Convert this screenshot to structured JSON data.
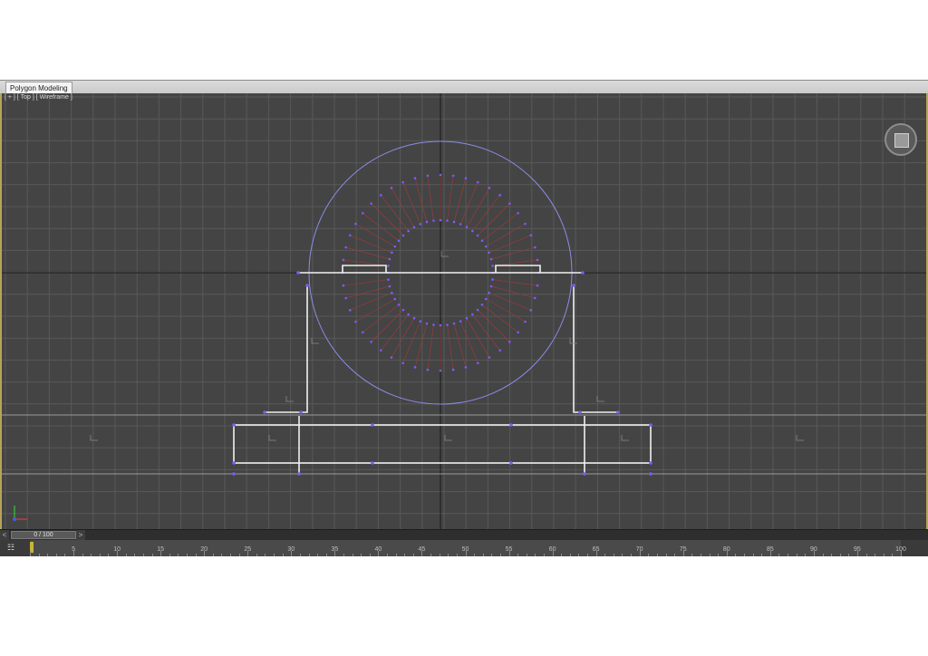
{
  "ribbon": {
    "panel_label": "Polygon Modeling"
  },
  "viewport": {
    "label_parts": [
      "[ + ]",
      "[ Top ]",
      "[ Wireframe ]"
    ],
    "view": "Top",
    "shading": "Wireframe",
    "colors": {
      "background": "#444444",
      "grid": "#595959",
      "axis": "#1a1a1a",
      "shape_white": "#f0f0f0",
      "shape_blue": "#8c8ce8",
      "vertex": "#7a5cff",
      "spoke_red": "#9b3a3a",
      "active_border": "#b8a35a"
    }
  },
  "time_slider": {
    "label": "0 / 100",
    "left_arrow": "<",
    "right_arrow": ">"
  },
  "timeline": {
    "icon": "key-filter-icon",
    "ticks": [
      "5",
      "10",
      "15",
      "20",
      "25",
      "30",
      "35",
      "40",
      "45",
      "50",
      "55",
      "60",
      "65",
      "70",
      "75",
      "80",
      "85",
      "90",
      "95",
      "100"
    ]
  }
}
